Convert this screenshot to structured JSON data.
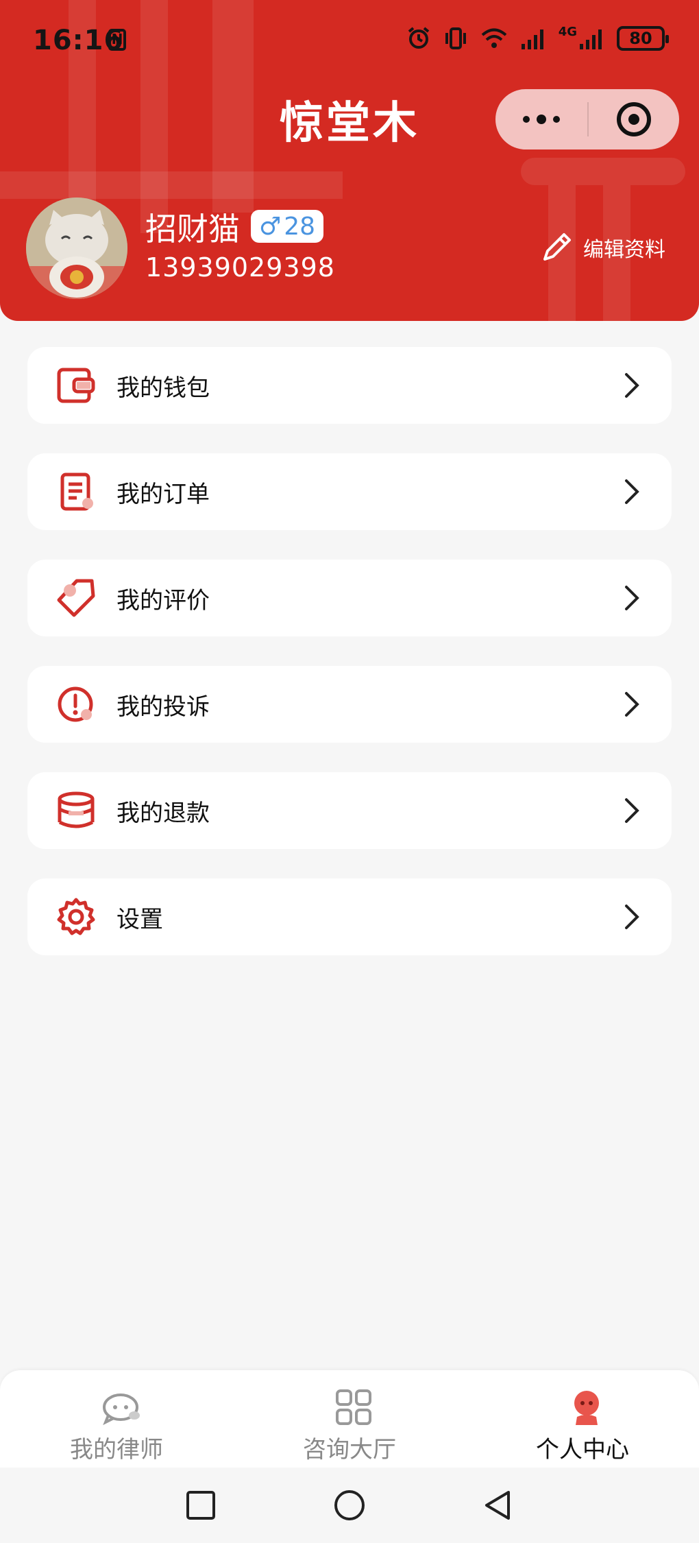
{
  "status_bar": {
    "time": "16:16",
    "nfc": "N",
    "network": "4G",
    "battery": "80"
  },
  "app": {
    "title": "惊堂木"
  },
  "capsule": {
    "more_icon": "more-dots-icon",
    "close_icon": "target-icon"
  },
  "profile": {
    "name": "招财猫",
    "gender_symbol": "♂",
    "age": "28",
    "phone": "13939029398",
    "edit_label": "编辑资料"
  },
  "menu": {
    "items": [
      {
        "label": "我的钱包",
        "icon": "wallet-icon"
      },
      {
        "label": "我的订单",
        "icon": "order-icon"
      },
      {
        "label": "我的评价",
        "icon": "tag-icon"
      },
      {
        "label": "我的投诉",
        "icon": "alert-icon"
      },
      {
        "label": "我的退款",
        "icon": "coins-icon"
      },
      {
        "label": "设置",
        "icon": "gear-icon"
      }
    ]
  },
  "tabbar": {
    "tabs": [
      {
        "label": "我的律师",
        "icon": "chat-bubble-icon",
        "active": false
      },
      {
        "label": "咨询大厅",
        "icon": "grid-icon",
        "active": false
      },
      {
        "label": "个人中心",
        "icon": "person-icon",
        "active": true
      }
    ]
  },
  "colors": {
    "brand_red": "#d42a22",
    "icon_red": "#d0302b",
    "background": "#f6f6f6"
  }
}
